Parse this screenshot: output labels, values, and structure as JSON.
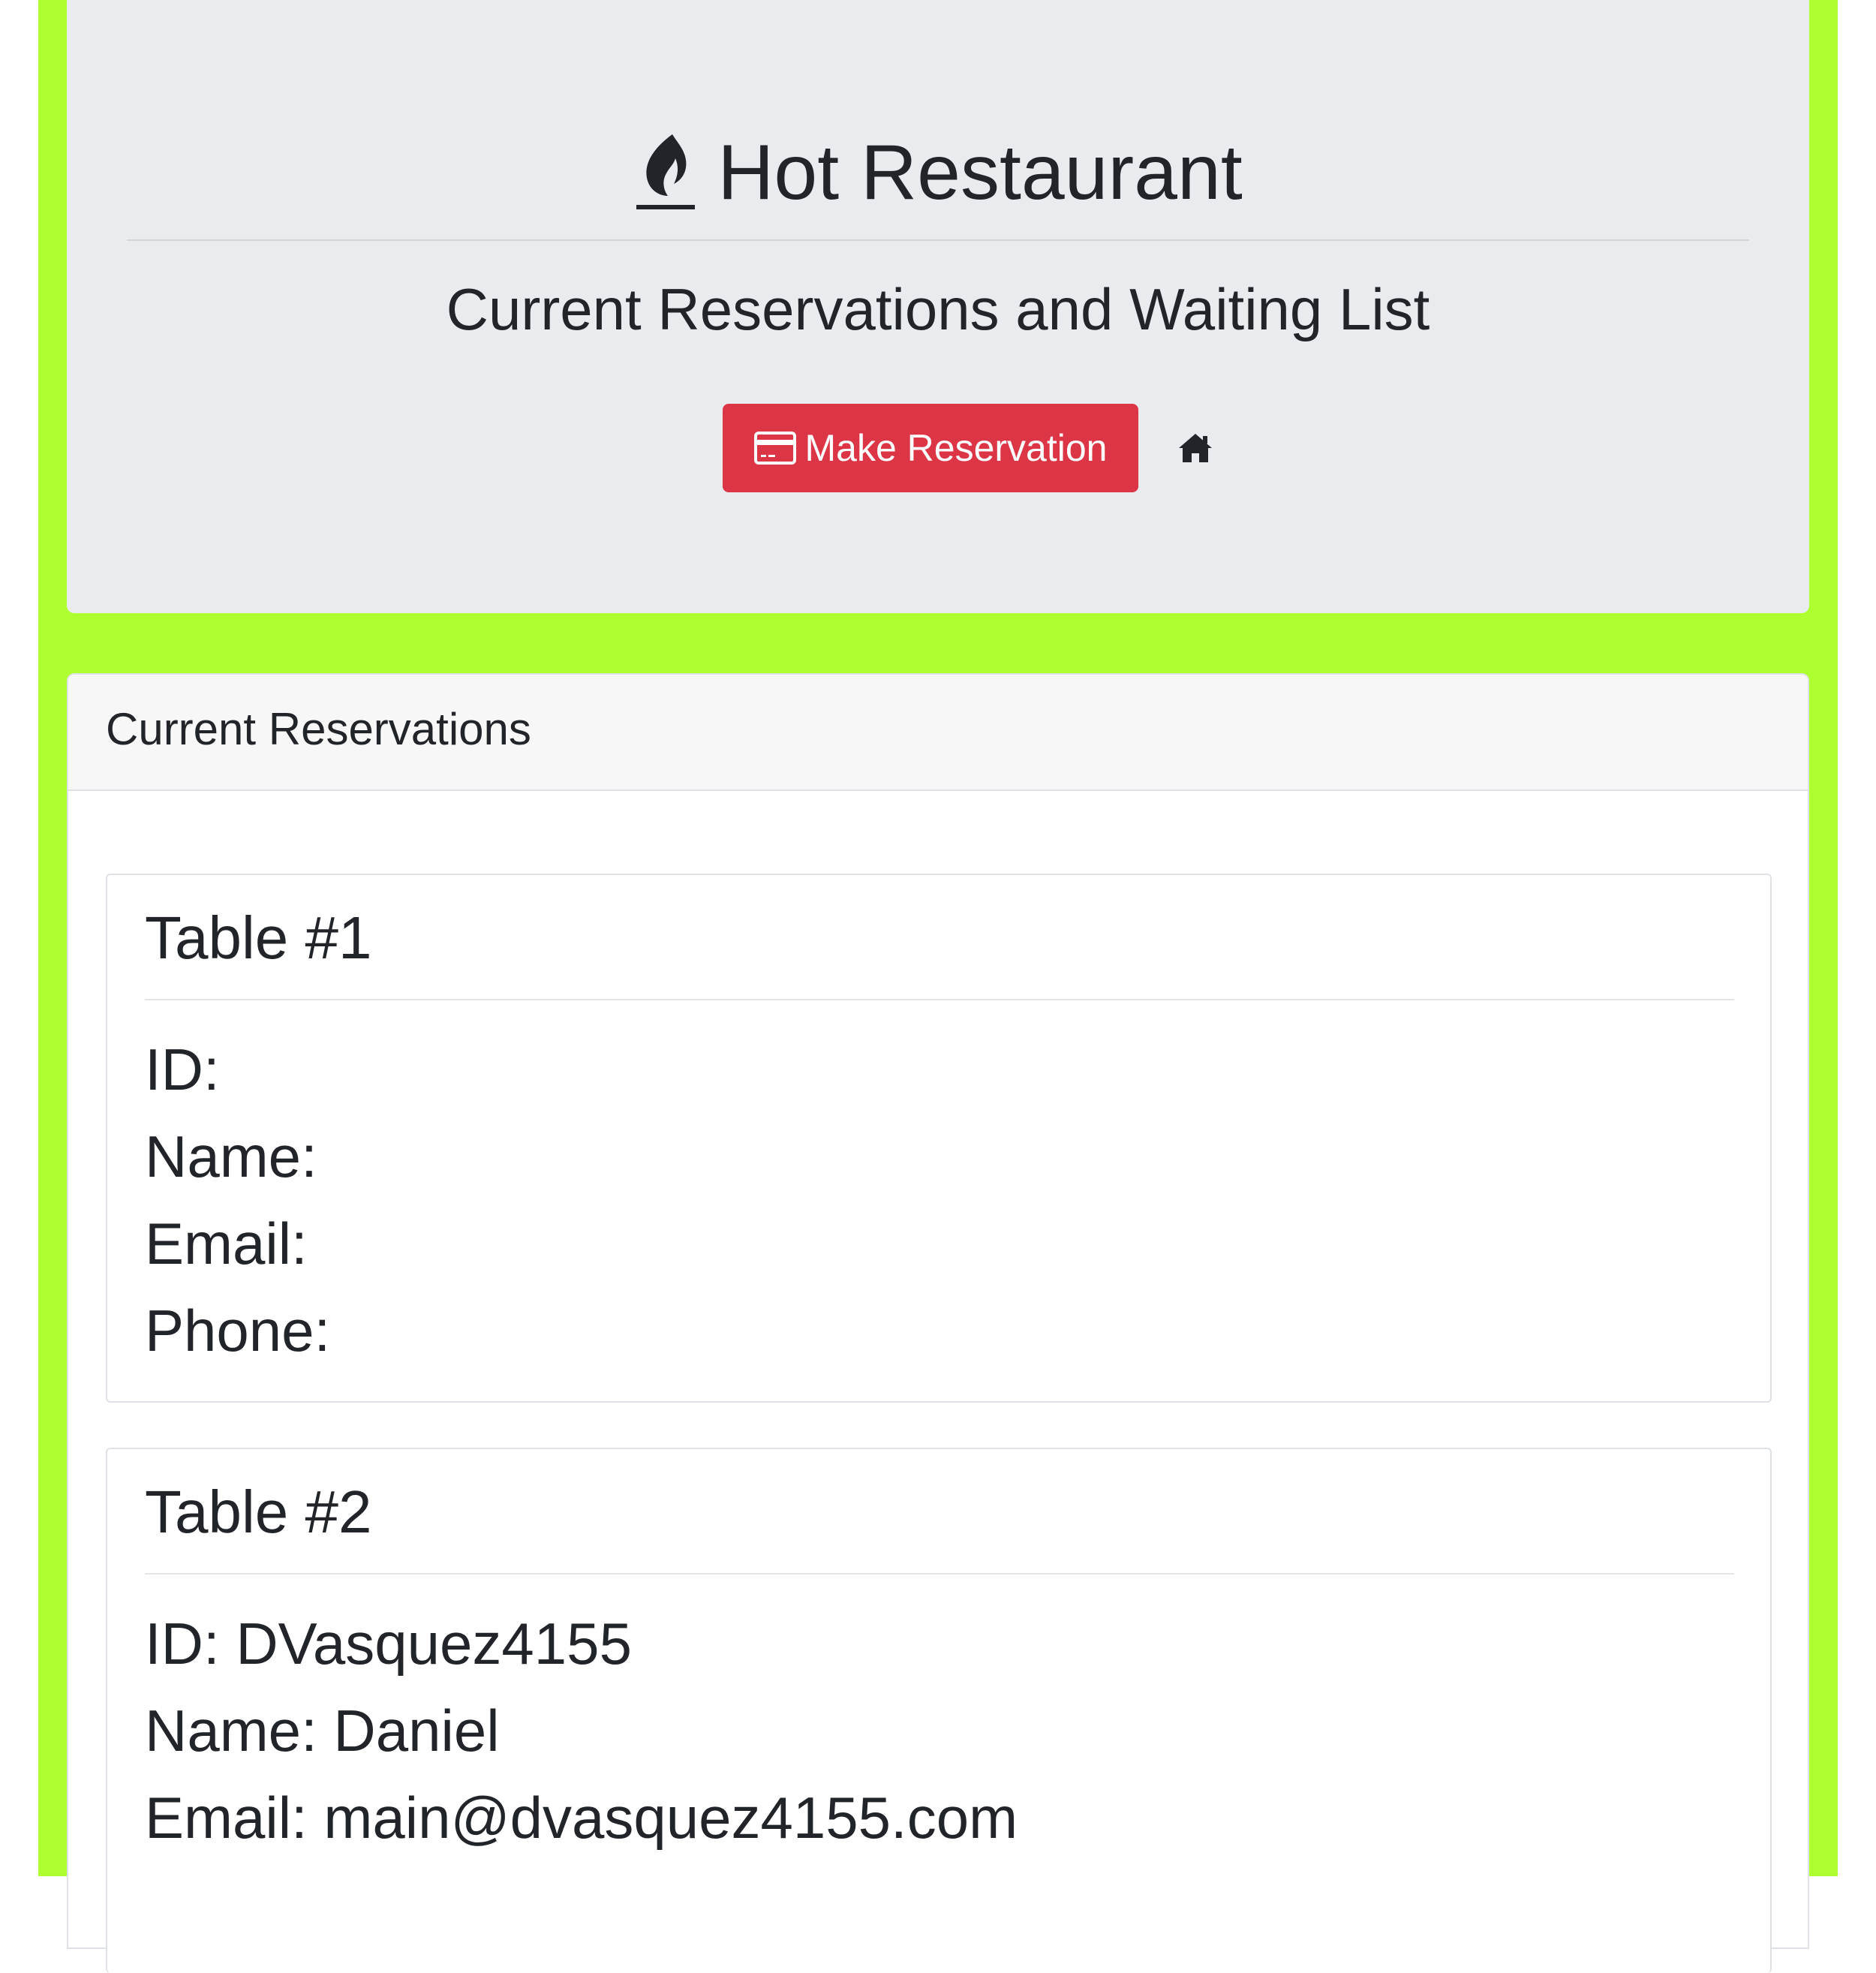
{
  "header": {
    "title": "Hot Restaurant",
    "subtitle": "Current Reservations and Waiting List",
    "reserve_button_label": "Make Reservation",
    "title_icon": "fire-icon",
    "reserve_icon": "credit-card-icon",
    "home_icon": "home-icon"
  },
  "colors": {
    "page_bg": "#adff2f",
    "jumbotron_bg": "#e9ecef",
    "button_bg": "#dc3545"
  },
  "reservations": {
    "header_label": "Current Reservations",
    "tables": [
      {
        "title": "Table #1",
        "id_line": "ID:",
        "name_line": "Name:",
        "email_line": "Email:",
        "phone_line": "Phone:"
      },
      {
        "title": "Table #2",
        "id_line": "ID: DVasquez4155",
        "name_line": "Name: Daniel",
        "email_line": "Email: main@dvasquez4155.com"
      }
    ]
  }
}
